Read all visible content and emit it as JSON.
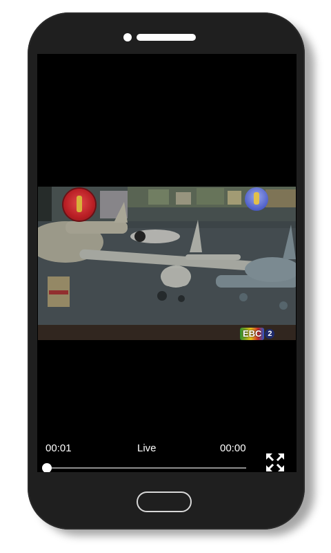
{
  "player": {
    "time_current": "00:01",
    "status_label": "Live",
    "time_total": "00:00",
    "progress_fraction": 0.0
  },
  "video": {
    "channel_badge_text": "EBC",
    "channel_badge_number": "2"
  },
  "icons": {
    "fullscreen": "fullscreen-expand-icon",
    "seek_thumb": "seek-thumb"
  },
  "colors": {
    "screen_background": "#000000",
    "phone_body": "#1f1f1f",
    "text": "#ffffff",
    "seekbar_track": "#8e8e8e"
  }
}
